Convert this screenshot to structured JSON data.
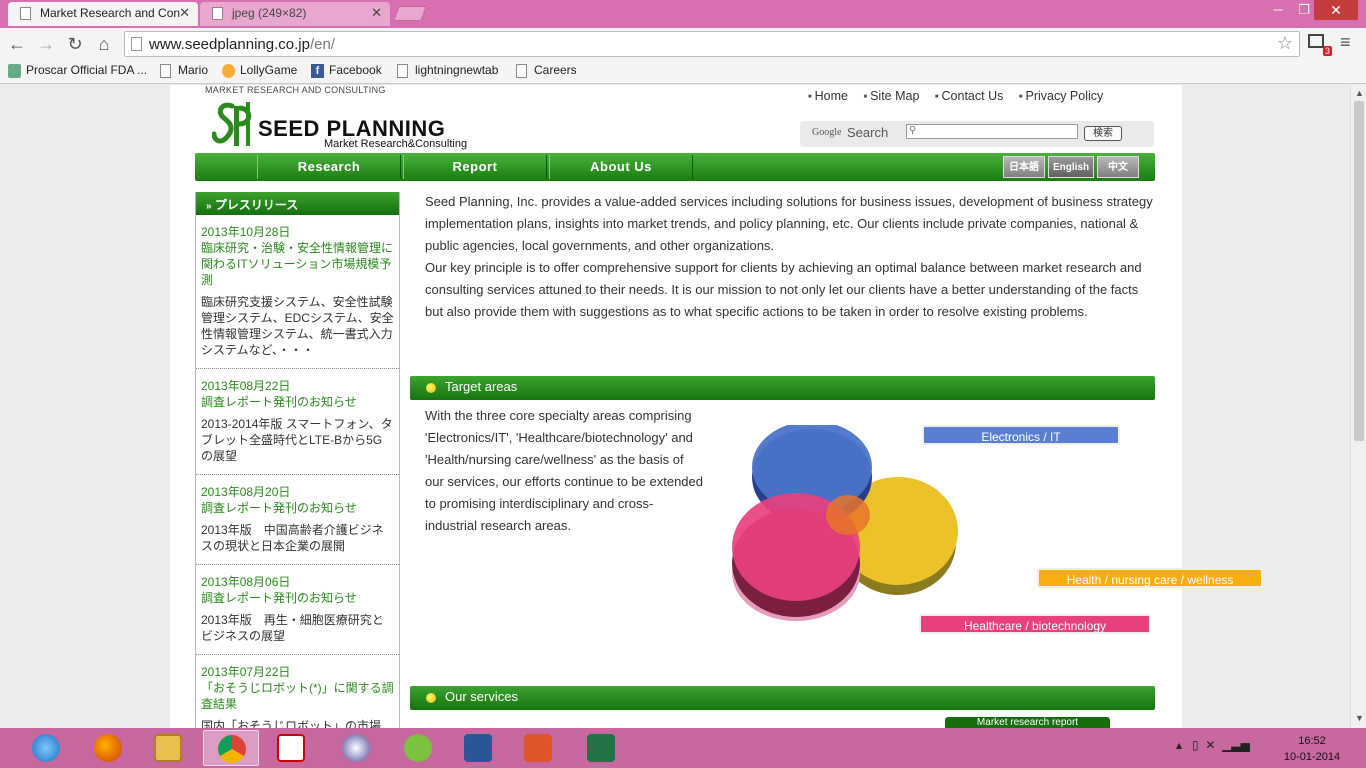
{
  "browser": {
    "tabs": [
      {
        "title": "Market Research and Con",
        "active": true
      },
      {
        "title": "jpeg (249×82)",
        "active": false
      }
    ],
    "url_host": "www.seedplanning.co.jp",
    "url_path": "/en/",
    "bookmarks": [
      "Proscar Official FDA ...",
      "Mario",
      "LollyGame",
      "Facebook",
      "lightningnewtab",
      "Careers"
    ],
    "extension_badge": "3"
  },
  "site": {
    "tagline": "MARKET RESEARCH AND CONSULTING",
    "logo_name": "SEED PLANNING",
    "logo_sub": "Market Research&Consulting",
    "toplinks": [
      "Home",
      "Site Map",
      "Contact Us",
      "Privacy Policy"
    ],
    "search": {
      "google": "Google",
      "label": "Search",
      "button": "検索"
    },
    "nav": [
      "Research",
      "Report",
      "About Us"
    ],
    "languages": [
      "日本語",
      "English",
      "中文"
    ],
    "sidebar_title": "プレスリリース",
    "news": [
      {
        "date": "2013年10月28日",
        "title": "臨床研究・治験・安全性情報管理に関わるITソリューション市場規模予測",
        "body": "臨床研究支援システム、安全性試験管理システム、EDCシステム、安全性情報管理システム、統一書式入力システムなど、・・・"
      },
      {
        "date": "2013年08月22日",
        "title": "調査レポート発刊のお知らせ",
        "body": "2013-2014年版 スマートフォン、タブレット全盛時代とLTE-Bから5Gの展望"
      },
      {
        "date": "2013年08月20日",
        "title": "調査レポート発刊のお知らせ",
        "body": "2013年版　中国高齢者介護ビジネスの現状と日本企業の展開"
      },
      {
        "date": "2013年08月06日",
        "title": "調査レポート発刊のお知らせ",
        "body": "2013年版　再生・細胞医療研究とビジネスの展望"
      },
      {
        "date": "2013年07月22日",
        "title": "「おそうじロボット(*)」に関する調査結果",
        "body": "国内「おそうじロボット」の市場"
      }
    ],
    "intro_p1": "Seed Planning, Inc. provides a value-added services including solutions for business issues, development of business strategy implementation plans, insights into market trends, and policy planning, etc. Our clients include private companies, national & public agencies, local governments, and other organizations.",
    "intro_p2": "Our key principle is to offer comprehensive support for clients by achieving an optimal balance between market research and consulting services attuned to their needs. It is our mission to not only let our clients have a better understanding of the facts but also provide them with suggestions as to what specific actions to be taken in order to resolve existing problems.",
    "target_title": "Target areas",
    "target_text": "With the three core specialty areas comprising 'Electronics/IT', 'Healthcare/biotechnology' and 'Health/nursing care/wellness' as the basis of our services, our efforts continue to be extended to promising interdisciplinary and cross-industrial research areas.",
    "areas": {
      "electronics": "Electronics / IT",
      "health": "Health / nursing care / wellness",
      "healthcare": "Healthcare / biotechnology"
    },
    "services_title": "Our services",
    "services_box": "Market research report"
  },
  "system": {
    "time": "16:52",
    "date": "10-01-2014"
  },
  "colors": {
    "green": "#2a8a1c",
    "taskbar": "#c7689f",
    "titlebar": "#d76fb0"
  }
}
